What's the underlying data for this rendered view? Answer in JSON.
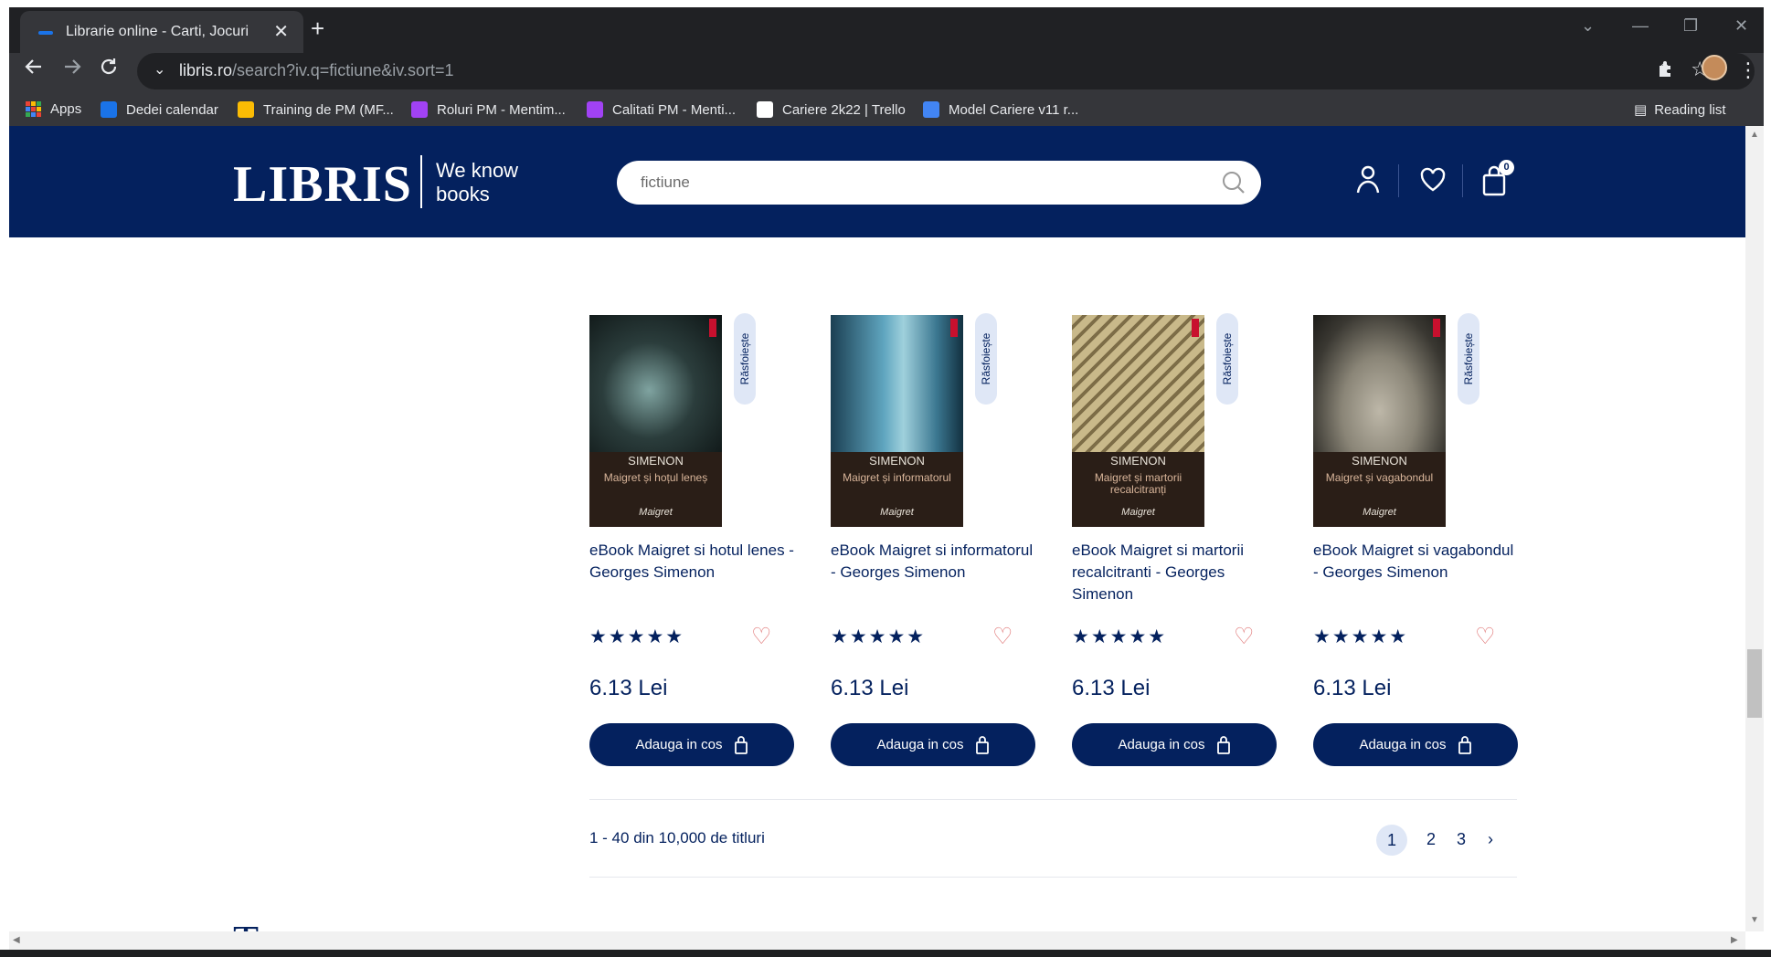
{
  "browser": {
    "tab_title": "Librarie online - Carti, Jocuri, Mu",
    "tab_close": "✕",
    "new_tab": "+",
    "url_host": "libris.ro",
    "url_path": "/search?iv.q=fictiune&iv.sort=1",
    "window_controls": [
      "⌄",
      "—",
      "❐",
      "✕"
    ]
  },
  "bookmarks": [
    {
      "label": "Apps",
      "color": "#ea4335"
    },
    {
      "label": "Dedei calendar",
      "color": "#1a73e8"
    },
    {
      "label": "Training de PM (MF...",
      "color": "#fbbc04"
    },
    {
      "label": "Roluri PM - Mentim...",
      "color": "#a142f4"
    },
    {
      "label": "Calitati PM - Menti...",
      "color": "#a142f4"
    },
    {
      "label": "Cariere 2k22 | Trello",
      "color": "#ffffff"
    },
    {
      "label": "Model Cariere v11 r...",
      "color": "#4285f4"
    }
  ],
  "reading_list": "Reading list",
  "site": {
    "logo": "LIBRIS",
    "tagline_line1": "We know",
    "tagline_line2": "books",
    "search_value": "fictiune",
    "cart_count": "0",
    "brand_color": "#04215e"
  },
  "products": [
    {
      "name": "eBook Maigret si hotul lenes - Georges Simenon",
      "cover_author": "SIMENON",
      "cover_title": "Maigret și hoțul leneș",
      "rating": 5,
      "price": "6.13 Lei",
      "add_label": "Adauga in cos",
      "browse_label": "Răsfoiește"
    },
    {
      "name": "eBook Maigret si informatorul - Georges Simenon",
      "cover_author": "SIMENON",
      "cover_title": "Maigret și informatorul",
      "rating": 5,
      "price": "6.13 Lei",
      "add_label": "Adauga in cos",
      "browse_label": "Răsfoiește"
    },
    {
      "name": "eBook Maigret si martorii recalcitranti - Georges Simenon",
      "cover_author": "SIMENON",
      "cover_title": "Maigret și martorii recalcitranți",
      "rating": 5,
      "price": "6.13 Lei",
      "add_label": "Adauga in cos",
      "browse_label": "Răsfoiește"
    },
    {
      "name": "eBook Maigret si vagabondul - Georges Simenon",
      "cover_author": "SIMENON",
      "cover_title": "Maigret și vagabondul",
      "rating": 5,
      "price": "6.13 Lei",
      "add_label": "Adauga in cos",
      "browse_label": "Răsfoiește"
    }
  ],
  "results": {
    "count_text": "1 - 40 din 10,000 de titluri",
    "pages": [
      "1",
      "2",
      "3"
    ],
    "next": "›",
    "current_page": "1"
  },
  "stars_text": "★★★★★"
}
